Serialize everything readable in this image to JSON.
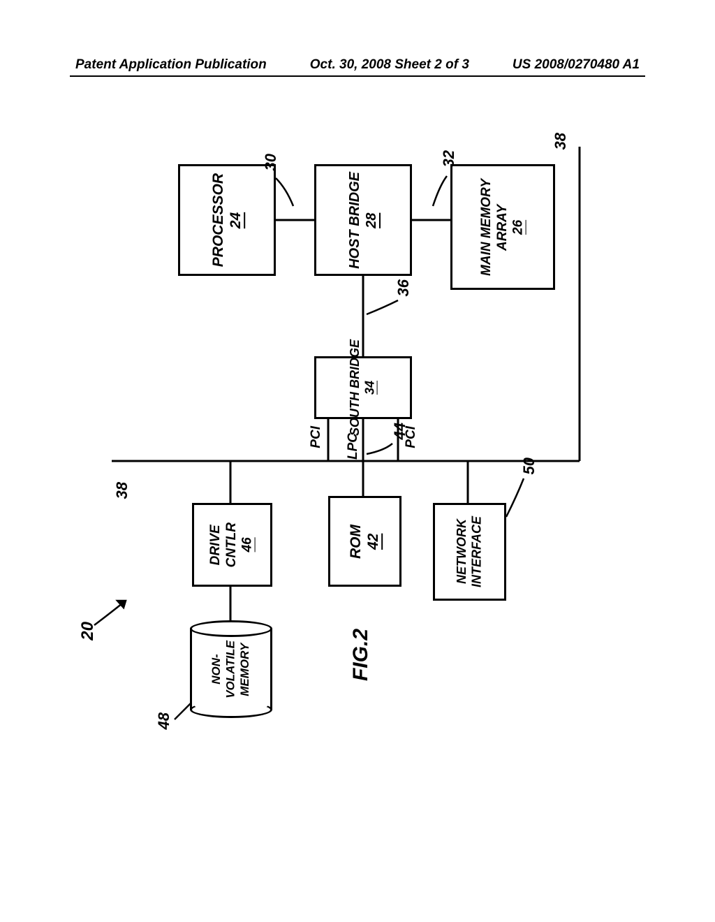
{
  "header": {
    "left": "Patent Application Publication",
    "mid": "Oct. 30, 2008  Sheet 2 of 3",
    "right": "US 2008/0270480 A1"
  },
  "figure": {
    "caption": "FIG.2",
    "system_ref": "20"
  },
  "blocks": {
    "processor": {
      "label": "PROCESSOR",
      "ref": "24"
    },
    "host_bridge": {
      "label": "HOST BRIDGE",
      "ref": "28"
    },
    "main_memory": {
      "label1": "MAIN MEMORY",
      "label2": "ARRAY",
      "ref": "26"
    },
    "south_bridge": {
      "label": "SOUTH BRIDGE",
      "ref": "34"
    },
    "drive_cntlr": {
      "label1": "DRIVE",
      "label2": "CNTLR",
      "ref": "46"
    },
    "rom": {
      "label": "ROM",
      "ref": "42"
    },
    "net_if": {
      "label1": "NETWORK",
      "label2": "INTERFACE",
      "ref": ""
    },
    "nv_mem": {
      "label1": "NON-",
      "label2": "VOLATILE",
      "label3": "MEMORY",
      "ref": ""
    }
  },
  "callouts": {
    "proc_bus": "30",
    "mem_bus": "32",
    "hub_link": "36",
    "pci_left": "38",
    "pci_right": "38",
    "lpc": "44",
    "nv": "48",
    "net": "50"
  },
  "bus_labels": {
    "pci_l": "PCI",
    "pci_r": "PCI",
    "lpc": "LPC"
  }
}
